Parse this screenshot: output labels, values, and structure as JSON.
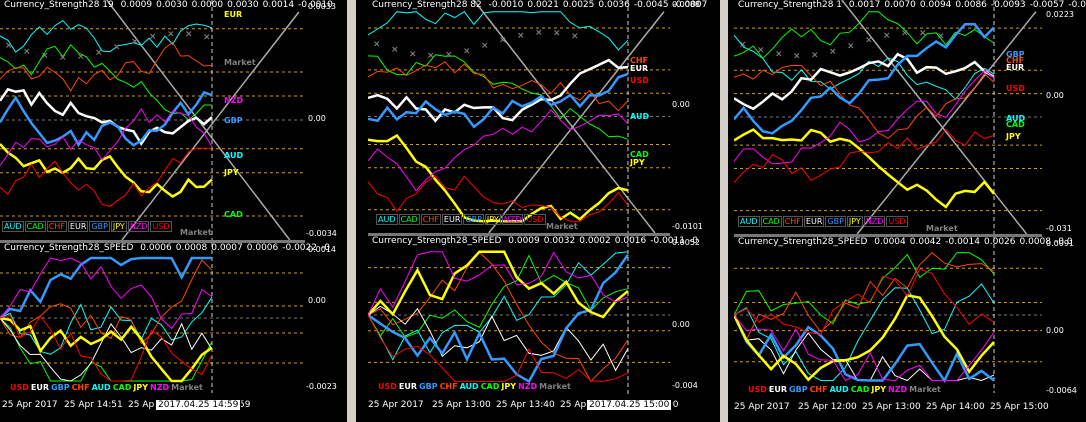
{
  "colors": {
    "AUD": "#00ffff",
    "CAD": "#00ff00",
    "CHF": "#ff4500",
    "EUR": "#ffffff",
    "GBP": "#3399ff",
    "JPY": "#ffff00",
    "NZD": "#ff00ff",
    "USD": "#ff0000",
    "Market": "#808080"
  },
  "currencies": [
    "AUD",
    "CAD",
    "CHF",
    "EUR",
    "GBP",
    "JPY",
    "NZD",
    "USD"
  ],
  "speed_currencies": [
    "USD",
    "EUR",
    "GBP",
    "CHF",
    "AUD",
    "CAD",
    "JPY",
    "NZD",
    "Market"
  ],
  "market_label": "Market",
  "windows": [
    {
      "strength_title": "Currency_Strength28 19",
      "strength_values": [
        "0.0009",
        "0.0030",
        "0.0000",
        "0.0030",
        "0.0014",
        "-0.0010"
      ],
      "strength_y": [
        "0.0033",
        "0.00",
        "-0.0034"
      ],
      "strength_right_labels": [
        "EUR",
        "NZD",
        "GBP",
        "AUD",
        "JPY",
        "CAD"
      ],
      "speed_title": "Currency_Strength28_SPEED",
      "speed_values": [
        "0.0006",
        "0.0008",
        "0.0007",
        "0.0006",
        "-0.0022",
        "-0"
      ],
      "speed_y": [
        "0.0014",
        "0.00",
        "-0.0023"
      ],
      "x_ticks": [
        "25 Apr 2017",
        "25 Apr 14:51",
        "25 Ap",
        ":59"
      ],
      "crosshair_time": "2017.04.25 14:59"
    },
    {
      "strength_title": "Currency_Strength28 82",
      "strength_values": [
        "-0.0010",
        "0.0021",
        "0.0025",
        "0.0036",
        "-0.0045",
        "-0.0007"
      ],
      "strength_y": [
        "0.0088",
        "0.00",
        "-0.0101"
      ],
      "strength_right_labels": [
        "CHF",
        "EUR",
        "USD",
        "AUD",
        "CAD",
        "JPY"
      ],
      "speed_title": "Currency_Strength28_SPEED",
      "speed_values": [
        "0.0009",
        "0.0032",
        "0.0002",
        "0.0016",
        "-0.0011",
        "-0"
      ],
      "speed_y": [
        "0.0052",
        "0.00",
        "-0.004"
      ],
      "x_ticks": [
        "25 Apr 2017",
        "25 Apr 13:00",
        "25 Apr 13:40",
        "25 Ap",
        ":00"
      ],
      "crosshair_time": "2017.04.25 15:00"
    },
    {
      "strength_title": "Currency_Strength28 1",
      "strength_values": [
        "0.0017",
        "0.0070",
        "0.0094",
        "0.0086",
        "-0.0093",
        "-0.0057",
        "-0.0"
      ],
      "strength_y": [
        "0.0223",
        "0.00",
        "-0.031"
      ],
      "strength_right_labels": [
        "GBP",
        "CHF",
        "EUR",
        "USD",
        "AUD",
        "CAD",
        "JPY"
      ],
      "speed_title": "Currency_Strength28_SPEED",
      "speed_values": [
        "0.0004",
        "0.0042",
        "-0.0014",
        "0.0026",
        "0.0008",
        "-0.0"
      ],
      "speed_y": [
        "0.0091",
        "0.00",
        "-0.0064"
      ],
      "x_ticks": [
        "25 Apr 2017",
        "25 Apr 12:00",
        "25 Apr 13:00",
        "25 Apr 14:00",
        "25 Apr 15:00"
      ],
      "crosshair_time": ""
    }
  ]
}
